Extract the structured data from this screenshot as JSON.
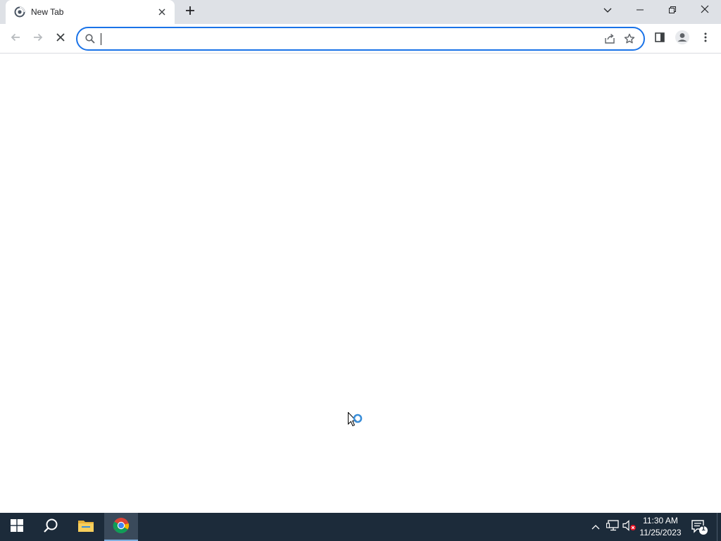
{
  "browser": {
    "tab": {
      "title": "New Tab",
      "favicon": "chrome-new-tab-icon"
    },
    "window_controls": [
      "tab-search",
      "minimize",
      "restore",
      "close"
    ],
    "toolbar": {
      "back_icon": "arrow-left-icon",
      "forward_icon": "arrow-right-icon",
      "stop_icon": "close-icon",
      "omnibox": {
        "value": "",
        "placeholder": ""
      },
      "right_icons": [
        "share-icon",
        "star-icon",
        "side-panel-icon",
        "profile-icon",
        "kebab-menu-icon"
      ]
    }
  },
  "page": {
    "state": "loading",
    "cursor": "busy-arrow"
  },
  "taskbar": {
    "pinned": [
      "windows-start-icon",
      "search-icon",
      "file-explorer-icon",
      "chrome-icon"
    ],
    "active": "chrome-icon",
    "tray": [
      "chevron-up-icon",
      "network-icon",
      "volume-muted-icon"
    ],
    "clock": {
      "time": "11:30 AM",
      "date": "11/25/2023"
    },
    "notifications": {
      "count": "1"
    }
  },
  "colors": {
    "accent": "#1a73e8",
    "tabstrip": "#dee1e6",
    "taskbar": "#1c2b3a",
    "busy_ring": "#3b8fd9"
  }
}
